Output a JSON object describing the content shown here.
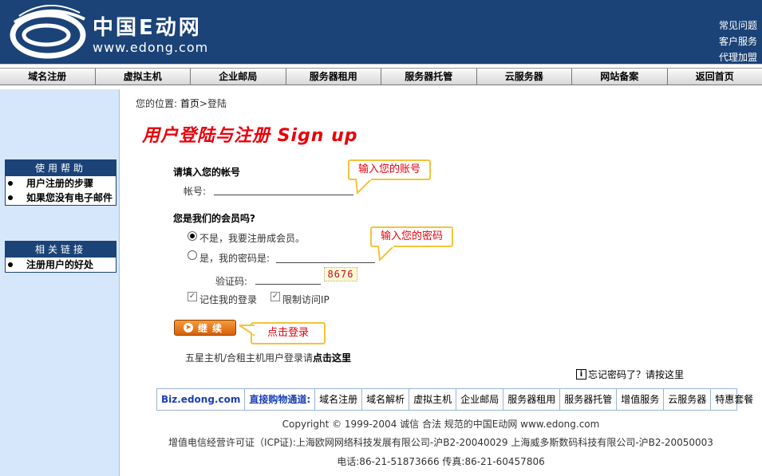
{
  "header": {
    "brand_cn": "中国E动网",
    "brand_en": "www.edong.com",
    "links": [
      "常见问题",
      "客户服务",
      "代理加盟"
    ]
  },
  "nav": [
    "域名注册",
    "虚拟主机",
    "企业邮局",
    "服务器租用",
    "服务器托管",
    "云服务器",
    "网站备案",
    "返回首页"
  ],
  "sidebar": {
    "help_title": "使用帮助",
    "help_items": [
      "用户注册的步骤",
      "如果您没有电子邮件"
    ],
    "links_title": "相关链接",
    "links_items": [
      "注册用户的好处"
    ]
  },
  "breadcrumb": {
    "prefix": "您的位置:",
    "home": "首页",
    "separator": ">",
    "current": "登陆"
  },
  "title": "用户登陆与注册 Sign up",
  "form": {
    "account_heading": "请填入您的帐号",
    "account_label": "帐号:",
    "account_value": "",
    "member_heading": "您是我们的会员吗?",
    "radio_no": "不是，我要注册成会员。",
    "radio_yes": "是，我的密码是:",
    "password_value": "",
    "captcha_label": "验证码:",
    "captcha_value": "",
    "captcha_image_text": "8676",
    "remember_label": "记住我的登录",
    "limit_ip_label": "限制访问IP",
    "continue_label": "继续",
    "selected_radio": "no"
  },
  "callouts": {
    "account": "输入您的账号",
    "password": "输入您的密码",
    "login": "点击登录"
  },
  "five_star": {
    "text": "五星主机/合租主机用户登录请",
    "link": "点击这里"
  },
  "forgot": "忘记密码了？请按这里",
  "footer_links": {
    "brand": "Biz.edong.com",
    "channel": "直接购物通道:",
    "items": [
      "域名注册",
      "域名解析",
      "虚拟主机",
      "企业邮局",
      "服务器租用",
      "服务器托管",
      "增值服务",
      "云服务器",
      "特惠套餐"
    ]
  },
  "footer": {
    "copyright": "Copyright © 1999-2004 诚信 合法 规范的中国E动网 www.edong.com",
    "icp": "增值电信经营许可证（ICP证):上海欧网网络科技发展有限公司-沪B2-20040029 上海威多斯数码科技有限公司-沪B2-20050003",
    "contact": "电话:86-21-51873666 传真:86-21-60457806"
  },
  "colors": {
    "header_bg": "#1b4378",
    "title_red": "#e8000b",
    "callout_border": "#f5c23c",
    "sidebar_bg": "#d7e7fb"
  }
}
